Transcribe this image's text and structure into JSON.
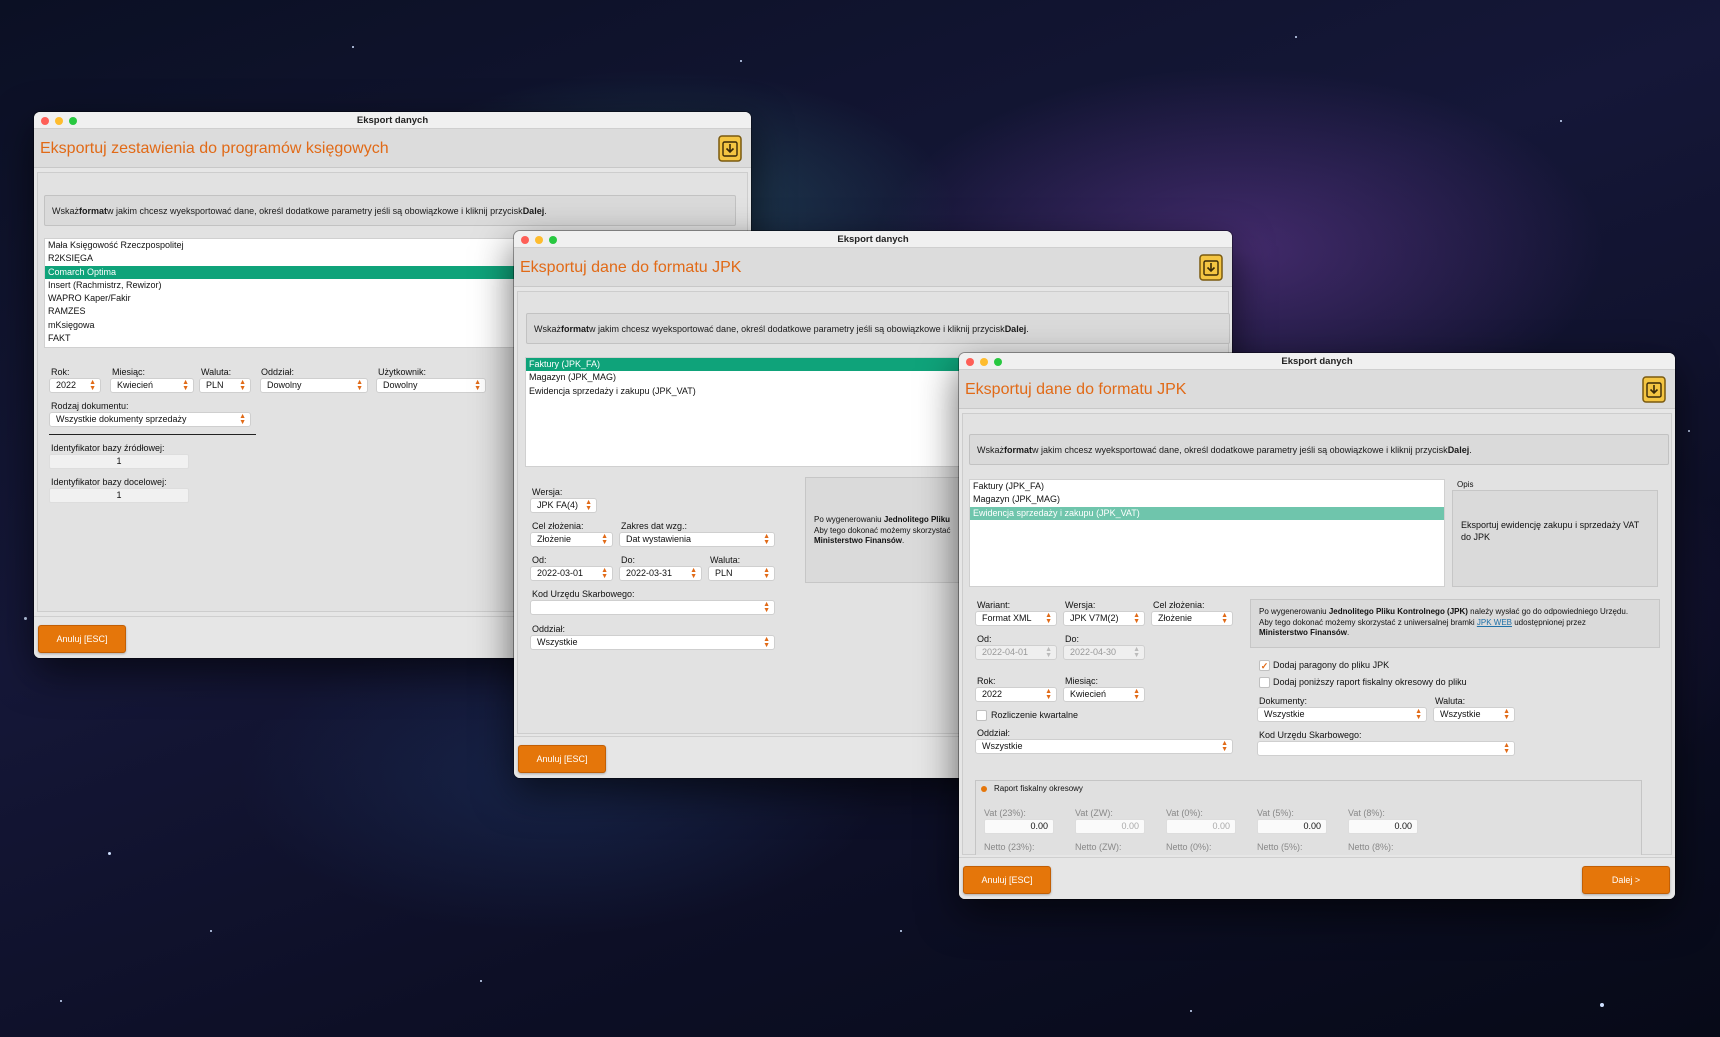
{
  "w1": {
    "window_title": "Eksport danych",
    "header_title": "Eksportuj zestawienia do programów księgowych",
    "instr_pre": "Wskaż ",
    "instr_bold": "format",
    "instr_mid": " w jakim chcesz wyeksportować dane, określ dodatkowe parametry jeśli są obowiązkowe i kliknij przycisk ",
    "instr_bold2": "Dalej",
    "instr_end": ".",
    "list": [
      {
        "label": "Mała Księgowość Rzeczpospolitej",
        "selected": false
      },
      {
        "label": "R2KSIĘGA",
        "selected": false
      },
      {
        "label": "Comarch Optima",
        "selected": true
      },
      {
        "label": "Insert (Rachmistrz, Rewizor)",
        "selected": false
      },
      {
        "label": "WAPRO Kaper/Fakir",
        "selected": false
      },
      {
        "label": "RAMZES",
        "selected": false
      },
      {
        "label": "mKsięgowa",
        "selected": false
      },
      {
        "label": "FAKT",
        "selected": false
      }
    ],
    "rok_label": "Rok:",
    "rok_value": "2022",
    "miesiac_label": "Miesiąc:",
    "miesiac_value": "Kwiecień",
    "waluta_label": "Waluta:",
    "waluta_value": "PLN",
    "oddzial_label": "Oddział:",
    "oddzial_value": "Dowolny",
    "uzytkownik_label": "Użytkownik:",
    "uzytkownik_value": "Dowolny",
    "rodzaj_label": "Rodzaj dokumentu:",
    "rodzaj_value": "Wszystkie dokumenty sprzedaży",
    "src_label": "Identyfikator bazy źródłowej:",
    "src_value": "1",
    "dst_label": "Identyfikator bazy docelowej:",
    "dst_value": "1",
    "cancel": "Anuluj [ESC]"
  },
  "w2": {
    "window_title": "Eksport danych",
    "header_title": "Eksportuj dane do formatu JPK",
    "instr_pre": "Wskaż ",
    "instr_bold": "format",
    "instr_mid": " w jakim chcesz wyeksportować dane, określ dodatkowe parametry jeśli są obowiązkowe i kliknij przycisk ",
    "instr_bold2": "Dalej",
    "instr_end": ".",
    "list": [
      {
        "label": "Faktury (JPK_FA)",
        "selected": true
      },
      {
        "label": "Magazyn (JPK_MAG)",
        "selected": false
      },
      {
        "label": "Ewidencja sprzedaży i zakupu (JPK_VAT)",
        "selected": false
      }
    ],
    "wersja_label": "Wersja:",
    "wersja_value": "JPK FA(4)",
    "cel_label": "Cel złożenia:",
    "cel_value": "Złożenie",
    "zakres_label": "Zakres dat wzg.:",
    "zakres_value": "Dat wystawienia",
    "od_label": "Od:",
    "od_value": "2022-03-01",
    "do_label": "Do:",
    "do_value": "2022-03-31",
    "waluta_label": "Waluta:",
    "waluta_value": "PLN",
    "kod_label": "Kod Urzędu Skarbowego:",
    "kod_value": "",
    "oddzial_label": "Oddział:",
    "oddzial_value": "Wszystkie",
    "info_pre": "Po wygenerowaniu ",
    "info_bold": "Jednolitego Pliku",
    "info_line2": "Aby tego dokonać możemy skorzystać",
    "info_bold2": "Ministerstwo Finansów",
    "info_end": ".",
    "cancel": "Anuluj [ESC]"
  },
  "w3": {
    "window_title": "Eksport danych",
    "header_title": "Eksportuj dane do formatu JPK",
    "instr_pre": "Wskaż ",
    "instr_bold": "format",
    "instr_mid": " w jakim chcesz wyeksportować dane, określ dodatkowe parametry jeśli są obowiązkowe i kliknij przycisk ",
    "instr_bold2": "Dalej",
    "instr_end": ".",
    "list": [
      {
        "label": "Faktury (JPK_FA)",
        "selected": false
      },
      {
        "label": "Magazyn (JPK_MAG)",
        "selected": false
      },
      {
        "label": "Ewidencja sprzedaży i zakupu (JPK_VAT)",
        "selected": true
      }
    ],
    "opis_label": "Opis",
    "opis_text": "Eksportuj ewidencję zakupu i sprzedaży VAT do JPK",
    "wariant_label": "Wariant:",
    "wariant_value": "Format XML",
    "wersja_label": "Wersja:",
    "wersja_value": "JPK V7M(2)",
    "cel_label": "Cel złożenia:",
    "cel_value": "Złożenie",
    "od_label": "Od:",
    "od_value": "2022-04-01",
    "do_label": "Do:",
    "do_value": "2022-04-30",
    "rok_label": "Rok:",
    "rok_value": "2022",
    "miesiac_label": "Miesiąc:",
    "miesiac_value": "Kwiecień",
    "kwartal_label": "Rozliczenie kwartalne",
    "oddzial_label": "Oddział:",
    "oddzial_value": "Wszystkie",
    "info_pre": "Po wygenerowaniu ",
    "info_bold": "Jednolitego Pliku Kontrolnego (JPK)",
    "info_mid": " należy wysłać go do odpowiedniego Urzędu.",
    "info_line2": "Aby tego dokonać możemy skorzystać z uniwersalnej bramki ",
    "info_link": "JPK WEB",
    "info_after_link": " udostępnionej przez",
    "info_bold2": "Ministerstwo Finansów",
    "info_end": ".",
    "paragony_label": "Dodaj paragony do pliku JPK",
    "paragony_checked": true,
    "raport_label": "Dodaj poniższy raport fiskalny okresowy do pliku",
    "raport_checked": false,
    "dokumenty_label": "Dokumenty:",
    "dokumenty_value": "Wszystkie",
    "waluta_label": "Waluta:",
    "waluta_value": "Wszystkie",
    "kod_label": "Kod Urzędu Skarbowego:",
    "kod_value": "",
    "fiscal_title": "Raport fiskalny okresowy",
    "vat": [
      {
        "label": "Vat (23%):",
        "value": "0.00",
        "enabled": true
      },
      {
        "label": "Vat (ZW):",
        "value": "0.00",
        "enabled": false
      },
      {
        "label": "Vat (0%):",
        "value": "0.00",
        "enabled": false
      },
      {
        "label": "Vat (5%):",
        "value": "0.00",
        "enabled": true
      },
      {
        "label": "Vat (8%):",
        "value": "0.00",
        "enabled": true
      }
    ],
    "netto": [
      "Netto (23%):",
      "Netto (ZW):",
      "Netto (0%):",
      "Netto (5%):",
      "Netto (8%):"
    ],
    "cancel": "Anuluj [ESC]",
    "next": "Dalej >"
  },
  "colors": {
    "accent": "#e16a17",
    "button": "#e5760a",
    "selection": "#0fa37a"
  }
}
